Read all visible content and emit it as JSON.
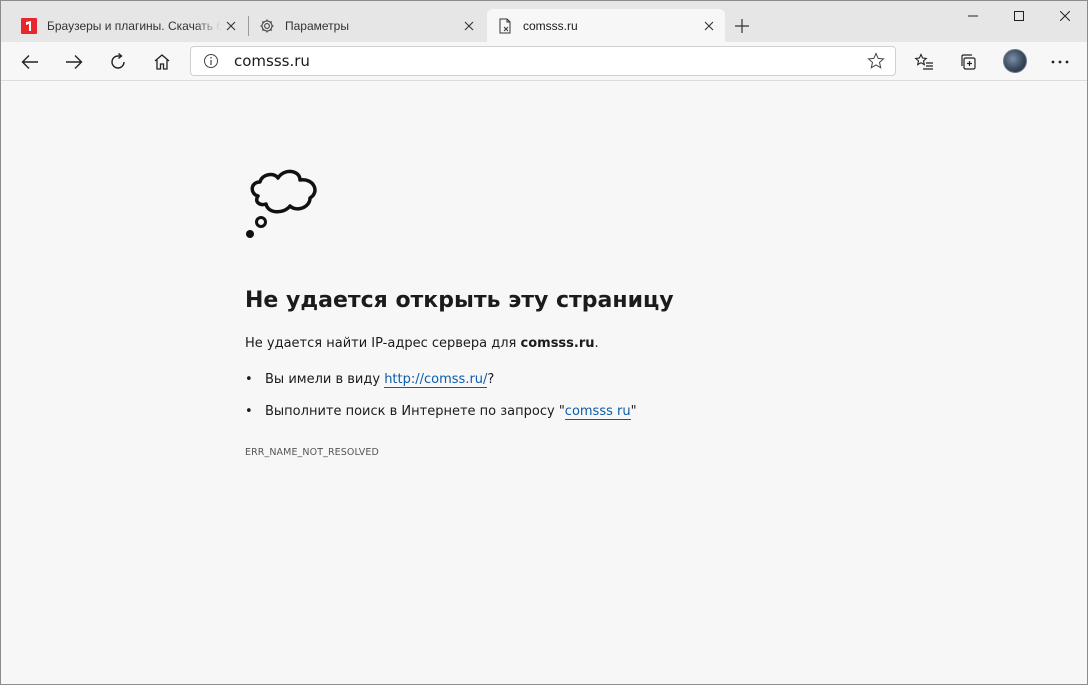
{
  "tabs": [
    {
      "title": "Браузеры и плагины. Скачать б",
      "favicon": "softportal-icon",
      "active": false
    },
    {
      "title": "Параметры",
      "favicon": "gear-icon",
      "active": false
    },
    {
      "title": "comsss.ru",
      "favicon": "page-icon",
      "active": true
    }
  ],
  "address_bar": {
    "url": "comsss.ru"
  },
  "error": {
    "title": "Не удается открыть эту страницу",
    "desc_prefix": "Не удается найти IP-адрес сервера для ",
    "desc_host": "comsss.ru",
    "desc_suffix": ".",
    "bullet1_prefix": "Вы имели в виду ",
    "bullet1_link": "http://comss.ru/",
    "bullet1_suffix": "?",
    "bullet2_prefix": "Выполните поиск в Интернете по запросу \"",
    "bullet2_link": "comsss ru",
    "bullet2_suffix": "\"",
    "bullet_symbol": "•",
    "code": "ERR_NAME_NOT_RESOLVED"
  },
  "colors": {
    "link": "#0b5cad",
    "tabstrip": "#e6e6e6",
    "page": "#f7f7f7",
    "favicon_red": "#e8262d"
  }
}
